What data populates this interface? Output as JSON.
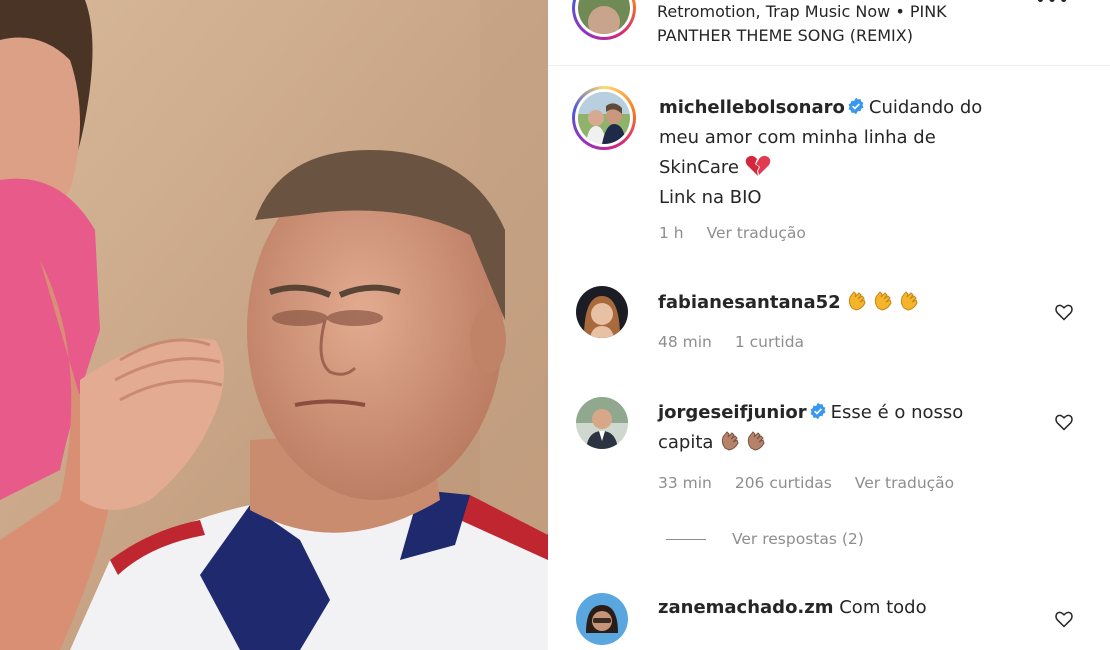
{
  "audio": {
    "line1": "Retromotion, Trap Music Now • PINK",
    "line2": "PANTHER THEME SONG (REMIX)",
    "more_icon": "more-dots-icon"
  },
  "caption": {
    "username": "michellebolsonaro",
    "text_line1": "Cuidando do",
    "text_line2": "meu amor com minha linha de",
    "text_line3": "SkinCare",
    "text_line4": "Link na BIO",
    "time": "1 h",
    "translate": "Ver tradução"
  },
  "comments": [
    {
      "username": "fabianesantana52",
      "time": "48 min",
      "likes": "1 curtida"
    },
    {
      "username": "jorgeseifjunior",
      "text1": "Esse é o nosso",
      "text2": "capita",
      "time": "33 min",
      "likes": "206 curtidas",
      "translate": "Ver tradução"
    },
    {
      "username": "zanemachado.zm",
      "text1": "Com todo"
    }
  ],
  "replies": {
    "label": "Ver respostas (2)"
  },
  "colors": {
    "verified": "#3897f0",
    "muted": "#8e8e8e",
    "text": "#262626",
    "divider": "#efefef"
  }
}
